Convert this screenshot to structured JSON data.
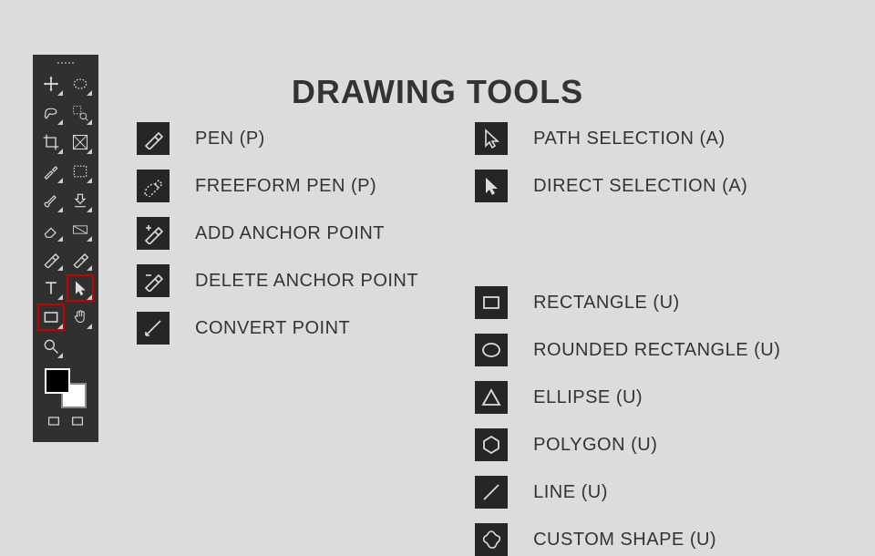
{
  "title": "DRAWING TOOLS",
  "legend": {
    "left": [
      {
        "id": "pen",
        "icon": "pen",
        "label": "PEN (P)"
      },
      {
        "id": "freeform-pen",
        "icon": "freeform-pen",
        "label": "FREEFORM PEN (P)"
      },
      {
        "id": "add-anchor",
        "icon": "add-anchor",
        "label": "ADD ANCHOR POINT"
      },
      {
        "id": "delete-anchor",
        "icon": "delete-anchor",
        "label": "DELETE ANCHOR POINT"
      },
      {
        "id": "convert-point",
        "icon": "convert-point",
        "label": "CONVERT POINT"
      }
    ],
    "right": [
      {
        "id": "path-selection",
        "icon": "arrow-outline",
        "label": "PATH SELECTION (A)"
      },
      {
        "id": "direct-selection",
        "icon": "arrow-solid",
        "label": "DIRECT SELECTION (A)"
      },
      {
        "id": "rectangle",
        "icon": "rect",
        "label": "RECTANGLE (U)"
      },
      {
        "id": "rounded-rectangle",
        "icon": "ellipse",
        "label": "ROUNDED RECTANGLE (U)"
      },
      {
        "id": "ellipse",
        "icon": "triangle",
        "label": "ELLIPSE (U)"
      },
      {
        "id": "polygon",
        "icon": "hexagon",
        "label": "POLYGON (U)"
      },
      {
        "id": "line",
        "icon": "line",
        "label": "LINE (U)"
      },
      {
        "id": "custom-shape",
        "icon": "blob",
        "label": "CUSTOM SHAPE (U)"
      }
    ]
  },
  "toolbar": {
    "tools": [
      {
        "id": "move",
        "icon": "move"
      },
      {
        "id": "marquee-ellipse",
        "icon": "marquee-ellipse"
      },
      {
        "id": "lasso",
        "icon": "lasso"
      },
      {
        "id": "quick-select",
        "icon": "quick-select"
      },
      {
        "id": "crop",
        "icon": "crop"
      },
      {
        "id": "slice",
        "icon": "slice"
      },
      {
        "id": "eyedropper",
        "icon": "eyedropper"
      },
      {
        "id": "marquee-rect",
        "icon": "marquee-rect"
      },
      {
        "id": "brush",
        "icon": "brush"
      },
      {
        "id": "stamp",
        "icon": "stamp"
      },
      {
        "id": "eraser",
        "icon": "eraser"
      },
      {
        "id": "gradient",
        "icon": "gradient"
      },
      {
        "id": "pen",
        "icon": "pen"
      },
      {
        "id": "pen2",
        "icon": "pen"
      },
      {
        "id": "type",
        "icon": "type",
        "selected": false
      },
      {
        "id": "path-selection",
        "icon": "arrow-solid",
        "selected": true
      },
      {
        "id": "rectangle",
        "icon": "rect",
        "selected": true
      },
      {
        "id": "hand",
        "icon": "hand",
        "selected": false
      },
      {
        "id": "zoom",
        "icon": "zoom"
      },
      {
        "id": "spacer",
        "icon": "none"
      }
    ]
  }
}
